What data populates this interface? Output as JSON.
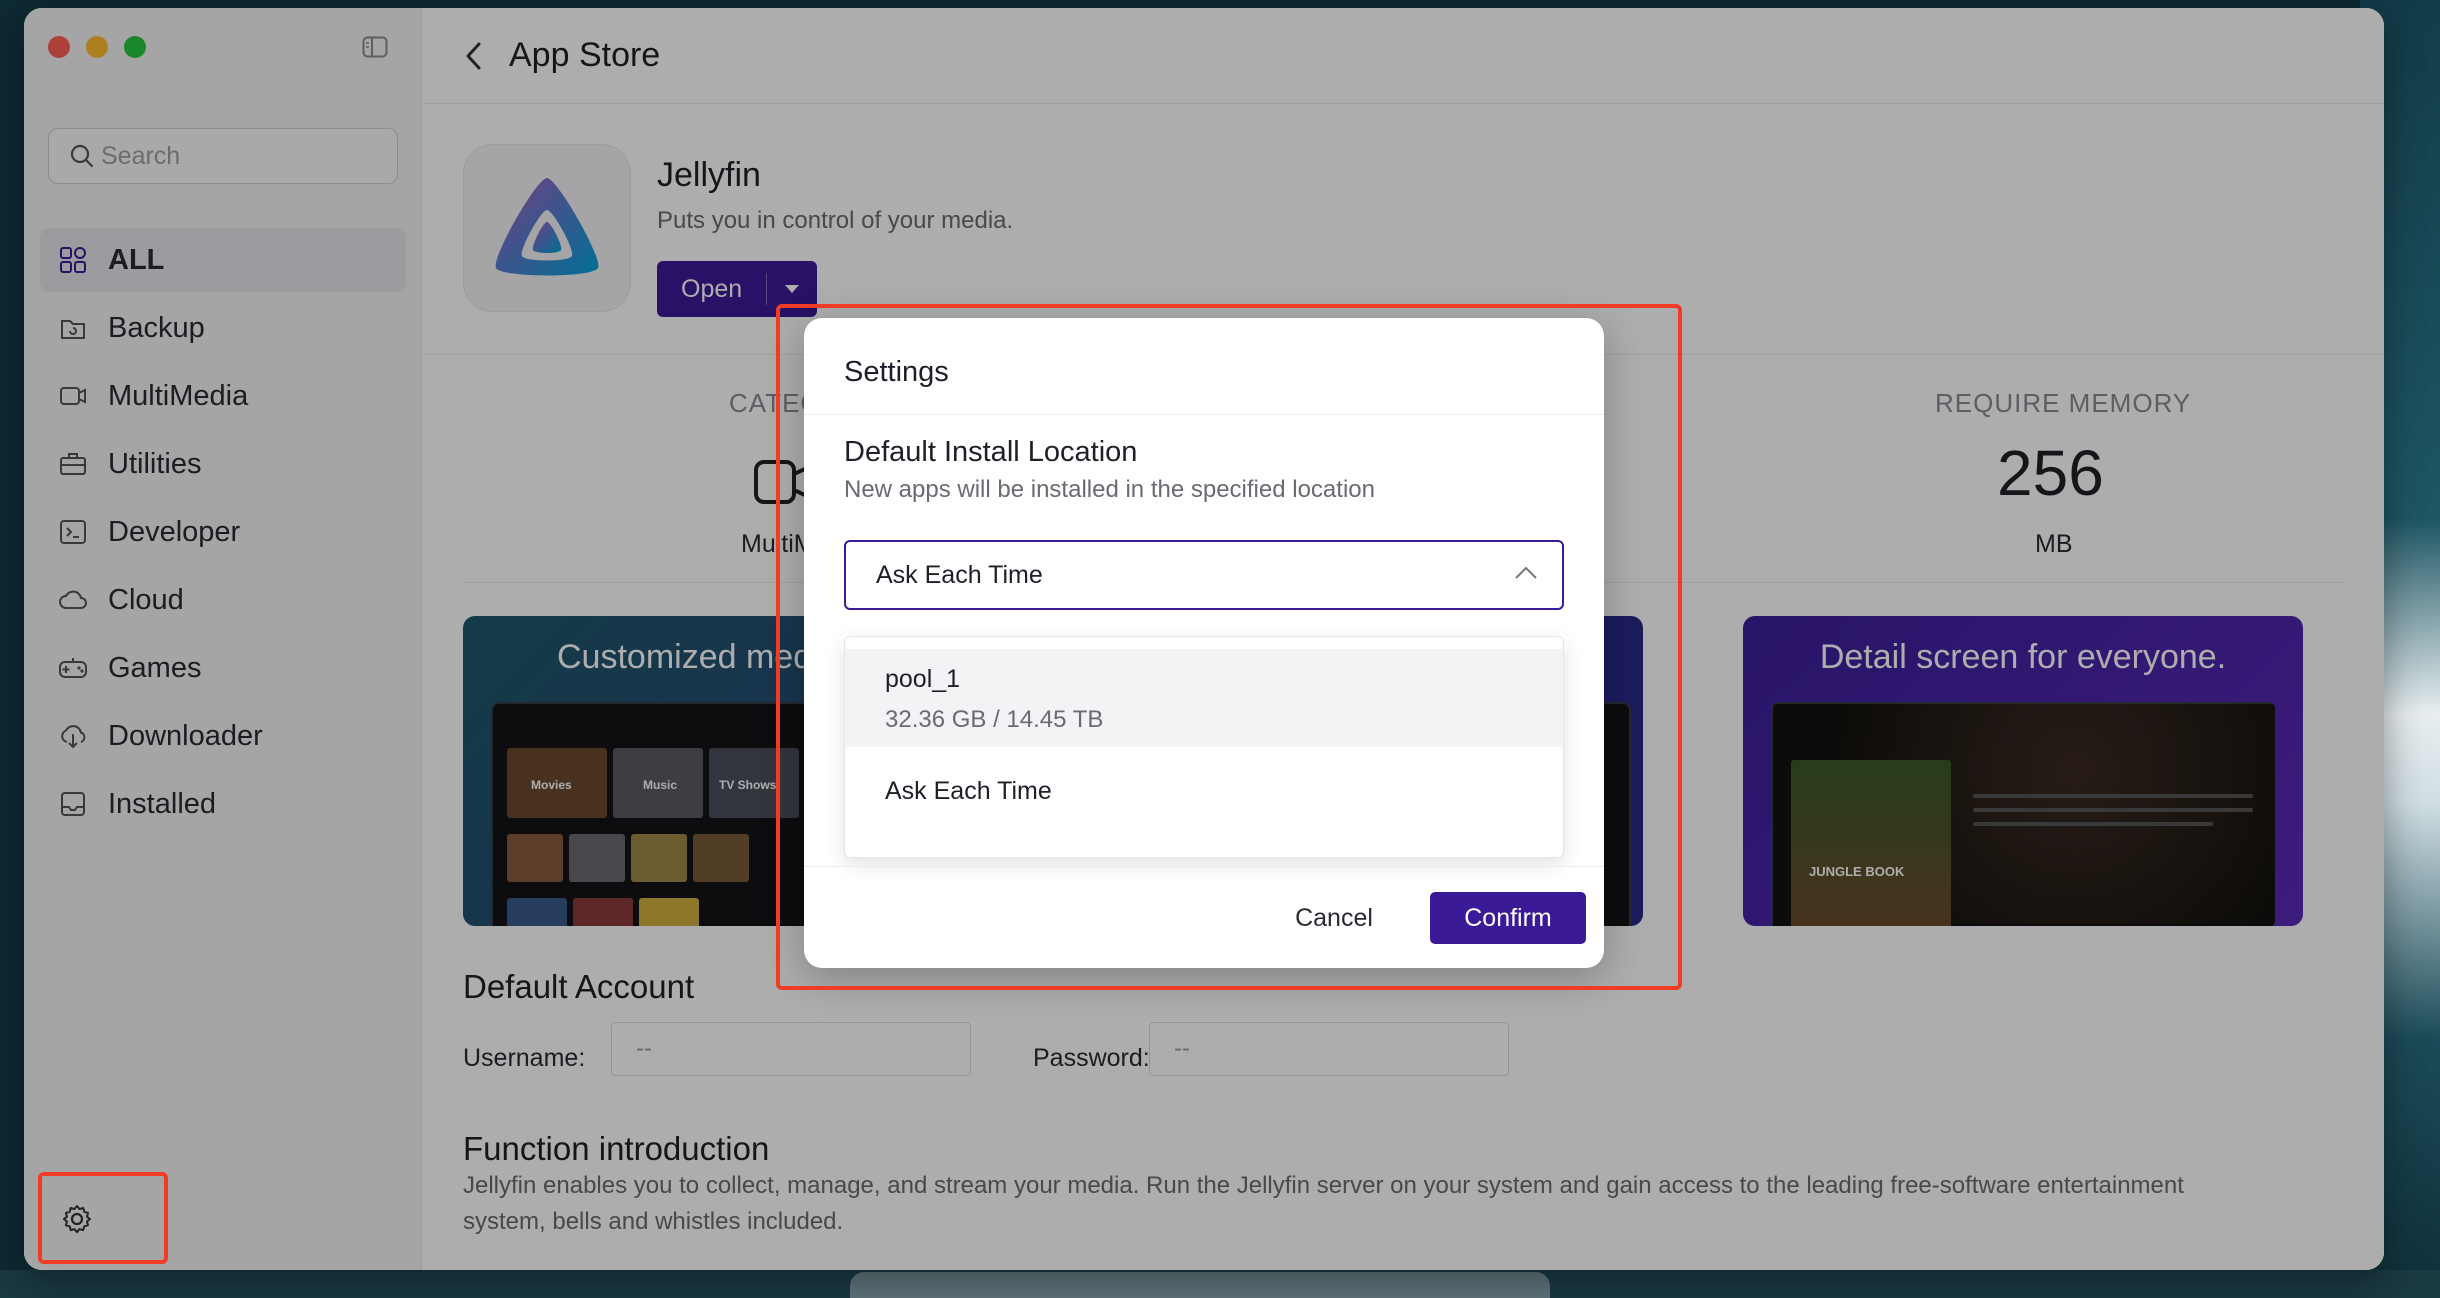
{
  "window": {
    "title": "App Store"
  },
  "sidebar": {
    "search_placeholder": "Search",
    "items": [
      {
        "label": "ALL",
        "icon": "grid-icon",
        "active": true
      },
      {
        "label": "Backup",
        "icon": "backup-icon"
      },
      {
        "label": "MultiMedia",
        "icon": "video-icon"
      },
      {
        "label": "Utilities",
        "icon": "toolbox-icon"
      },
      {
        "label": "Developer",
        "icon": "terminal-icon"
      },
      {
        "label": "Cloud",
        "icon": "cloud-icon"
      },
      {
        "label": "Games",
        "icon": "gamepad-icon"
      },
      {
        "label": "Downloader",
        "icon": "download-icon"
      },
      {
        "label": "Installed",
        "icon": "installed-icon"
      }
    ]
  },
  "app": {
    "name": "Jellyfin",
    "tagline": "Puts you in control of your media.",
    "open_label": "Open",
    "stats": {
      "category_label": "CATEGORY",
      "category_value": "MultiMedia",
      "memory_label": "REQUIRE MEMORY",
      "memory_value": "256",
      "memory_unit": "MB"
    },
    "screenshots": [
      {
        "title": "Customized media"
      },
      {
        "title": "Detail screen for everyone."
      }
    ],
    "screenshot_tiles": {
      "movies": "Movies",
      "music": "Music",
      "tv_shows": "TV Shows",
      "book": "JUNGLE BOOK"
    },
    "default_account": {
      "title": "Default Account",
      "username_label": "Username:",
      "username_value": "--",
      "password_label": "Password:",
      "password_value": "--"
    },
    "intro": {
      "title": "Function introduction",
      "text": "Jellyfin enables you to collect, manage, and stream your media. Run the Jellyfin server on your system and gain access to the leading free-software entertainment system, bells and whistles included."
    }
  },
  "modal": {
    "title": "Settings",
    "section_title": "Default Install Location",
    "section_sub": "New apps will be installed in the specified location",
    "selected": "Ask Each Time",
    "options": [
      {
        "name": "pool_1",
        "size": "32.36 GB / 14.45 TB"
      },
      {
        "name": "Ask Each Time"
      }
    ],
    "cancel_label": "Cancel",
    "confirm_label": "Confirm"
  },
  "colors": {
    "accent": "#3b1a98",
    "highlight": "#f03c24"
  }
}
